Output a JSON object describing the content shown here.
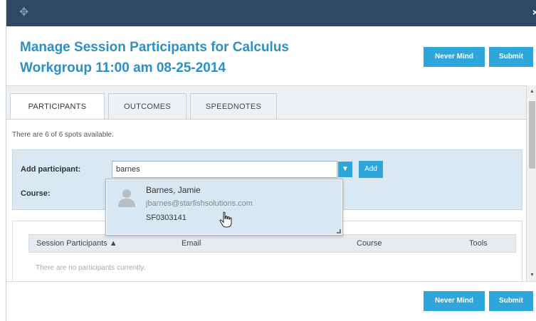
{
  "window": {
    "drag_icon": "move-icon",
    "close_label": "×"
  },
  "header": {
    "title": "Manage Session Participants for Calculus Workgroup 11:00 am 08-25-2014",
    "never_mind_label": "Never Mind",
    "submit_label": "Submit"
  },
  "tabs": [
    {
      "label": "PARTICIPANTS",
      "active": true
    },
    {
      "label": "OUTCOMES",
      "active": false
    },
    {
      "label": "SPEEDNOTES",
      "active": false
    }
  ],
  "spots_text": "There are 6 of 6 spots available.",
  "add_participant": {
    "label": "Add participant:",
    "value": "barnes",
    "add_label": "Add",
    "course_label": "Course:"
  },
  "results": [
    {
      "name": "Barnes, Jamie",
      "email": "jbarnes@starfishsolutions.com",
      "id": "SF0303141"
    }
  ],
  "table": {
    "headers": [
      "Session Participants ▲",
      "Email",
      "Course",
      "Tools"
    ],
    "empty_message": "There are no participants currently."
  },
  "footer": {
    "never_mind_label": "Never Mind",
    "submit_label": "Submit"
  },
  "colors": {
    "accent": "#2fa6da",
    "title": "#2d8fc4",
    "titlebar": "#2e4865"
  }
}
